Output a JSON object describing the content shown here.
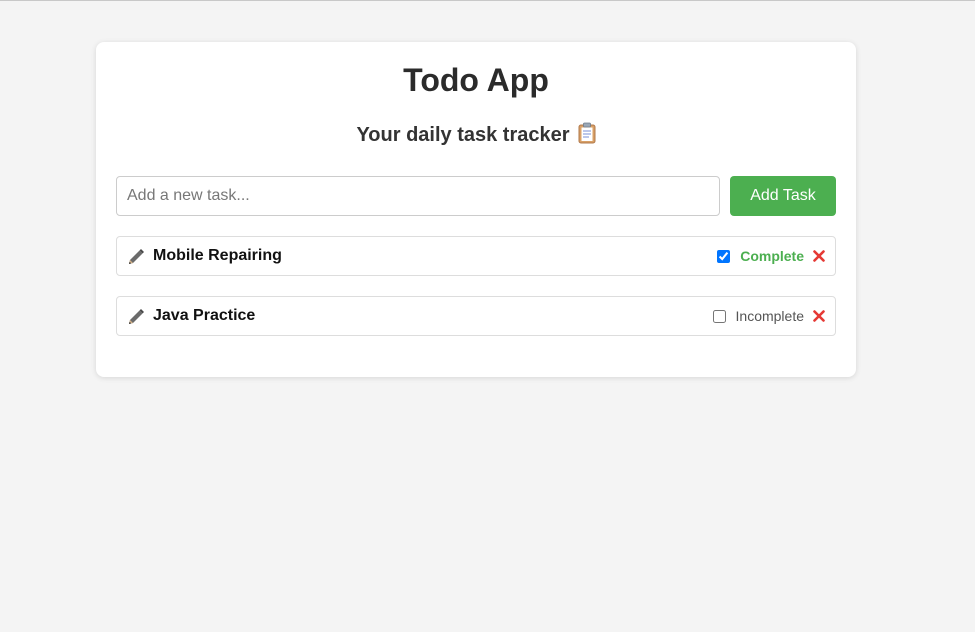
{
  "app": {
    "title": "Todo App",
    "subtitle": "Your daily task tracker",
    "subtitle_icon": "clipboard-icon"
  },
  "add_task": {
    "placeholder": "Add a new task...",
    "value": "",
    "button_label": "Add Task",
    "button_color": "#4caf50"
  },
  "tasks": [
    {
      "text": "Mobile Repairing",
      "checked": true,
      "status": "Complete",
      "status_color": "#4caf50",
      "edit_icon": "pencil-icon",
      "delete_icon": "close-icon"
    },
    {
      "text": "Java Practice",
      "checked": false,
      "status": "Incomplete",
      "status_color": "#555555",
      "edit_icon": "pencil-icon",
      "delete_icon": "close-icon"
    }
  ],
  "colors": {
    "delete": "#e53935",
    "background": "#f4f4f4",
    "card": "#ffffff"
  }
}
